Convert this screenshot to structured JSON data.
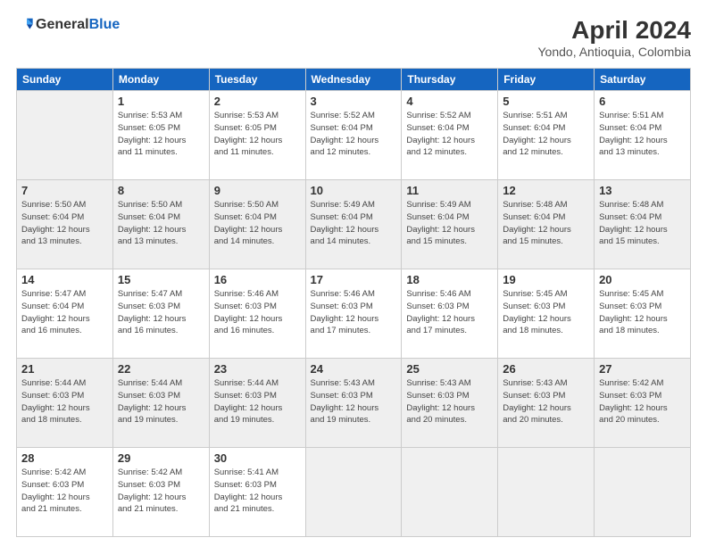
{
  "logo": {
    "text_general": "General",
    "text_blue": "Blue"
  },
  "title": "April 2024",
  "subtitle": "Yondo, Antioquia, Colombia",
  "days_of_week": [
    "Sunday",
    "Monday",
    "Tuesday",
    "Wednesday",
    "Thursday",
    "Friday",
    "Saturday"
  ],
  "weeks": [
    [
      {
        "day": "",
        "detail": ""
      },
      {
        "day": "1",
        "detail": "Sunrise: 5:53 AM\nSunset: 6:05 PM\nDaylight: 12 hours\nand 11 minutes."
      },
      {
        "day": "2",
        "detail": "Sunrise: 5:53 AM\nSunset: 6:05 PM\nDaylight: 12 hours\nand 11 minutes."
      },
      {
        "day": "3",
        "detail": "Sunrise: 5:52 AM\nSunset: 6:04 PM\nDaylight: 12 hours\nand 12 minutes."
      },
      {
        "day": "4",
        "detail": "Sunrise: 5:52 AM\nSunset: 6:04 PM\nDaylight: 12 hours\nand 12 minutes."
      },
      {
        "day": "5",
        "detail": "Sunrise: 5:51 AM\nSunset: 6:04 PM\nDaylight: 12 hours\nand 12 minutes."
      },
      {
        "day": "6",
        "detail": "Sunrise: 5:51 AM\nSunset: 6:04 PM\nDaylight: 12 hours\nand 13 minutes."
      }
    ],
    [
      {
        "day": "7",
        "detail": "Sunrise: 5:50 AM\nSunset: 6:04 PM\nDaylight: 12 hours\nand 13 minutes."
      },
      {
        "day": "8",
        "detail": "Sunrise: 5:50 AM\nSunset: 6:04 PM\nDaylight: 12 hours\nand 13 minutes."
      },
      {
        "day": "9",
        "detail": "Sunrise: 5:50 AM\nSunset: 6:04 PM\nDaylight: 12 hours\nand 14 minutes."
      },
      {
        "day": "10",
        "detail": "Sunrise: 5:49 AM\nSunset: 6:04 PM\nDaylight: 12 hours\nand 14 minutes."
      },
      {
        "day": "11",
        "detail": "Sunrise: 5:49 AM\nSunset: 6:04 PM\nDaylight: 12 hours\nand 15 minutes."
      },
      {
        "day": "12",
        "detail": "Sunrise: 5:48 AM\nSunset: 6:04 PM\nDaylight: 12 hours\nand 15 minutes."
      },
      {
        "day": "13",
        "detail": "Sunrise: 5:48 AM\nSunset: 6:04 PM\nDaylight: 12 hours\nand 15 minutes."
      }
    ],
    [
      {
        "day": "14",
        "detail": "Sunrise: 5:47 AM\nSunset: 6:04 PM\nDaylight: 12 hours\nand 16 minutes."
      },
      {
        "day": "15",
        "detail": "Sunrise: 5:47 AM\nSunset: 6:03 PM\nDaylight: 12 hours\nand 16 minutes."
      },
      {
        "day": "16",
        "detail": "Sunrise: 5:46 AM\nSunset: 6:03 PM\nDaylight: 12 hours\nand 16 minutes."
      },
      {
        "day": "17",
        "detail": "Sunrise: 5:46 AM\nSunset: 6:03 PM\nDaylight: 12 hours\nand 17 minutes."
      },
      {
        "day": "18",
        "detail": "Sunrise: 5:46 AM\nSunset: 6:03 PM\nDaylight: 12 hours\nand 17 minutes."
      },
      {
        "day": "19",
        "detail": "Sunrise: 5:45 AM\nSunset: 6:03 PM\nDaylight: 12 hours\nand 18 minutes."
      },
      {
        "day": "20",
        "detail": "Sunrise: 5:45 AM\nSunset: 6:03 PM\nDaylight: 12 hours\nand 18 minutes."
      }
    ],
    [
      {
        "day": "21",
        "detail": "Sunrise: 5:44 AM\nSunset: 6:03 PM\nDaylight: 12 hours\nand 18 minutes."
      },
      {
        "day": "22",
        "detail": "Sunrise: 5:44 AM\nSunset: 6:03 PM\nDaylight: 12 hours\nand 19 minutes."
      },
      {
        "day": "23",
        "detail": "Sunrise: 5:44 AM\nSunset: 6:03 PM\nDaylight: 12 hours\nand 19 minutes."
      },
      {
        "day": "24",
        "detail": "Sunrise: 5:43 AM\nSunset: 6:03 PM\nDaylight: 12 hours\nand 19 minutes."
      },
      {
        "day": "25",
        "detail": "Sunrise: 5:43 AM\nSunset: 6:03 PM\nDaylight: 12 hours\nand 20 minutes."
      },
      {
        "day": "26",
        "detail": "Sunrise: 5:43 AM\nSunset: 6:03 PM\nDaylight: 12 hours\nand 20 minutes."
      },
      {
        "day": "27",
        "detail": "Sunrise: 5:42 AM\nSunset: 6:03 PM\nDaylight: 12 hours\nand 20 minutes."
      }
    ],
    [
      {
        "day": "28",
        "detail": "Sunrise: 5:42 AM\nSunset: 6:03 PM\nDaylight: 12 hours\nand 21 minutes."
      },
      {
        "day": "29",
        "detail": "Sunrise: 5:42 AM\nSunset: 6:03 PM\nDaylight: 12 hours\nand 21 minutes."
      },
      {
        "day": "30",
        "detail": "Sunrise: 5:41 AM\nSunset: 6:03 PM\nDaylight: 12 hours\nand 21 minutes."
      },
      {
        "day": "",
        "detail": ""
      },
      {
        "day": "",
        "detail": ""
      },
      {
        "day": "",
        "detail": ""
      },
      {
        "day": "",
        "detail": ""
      }
    ]
  ]
}
